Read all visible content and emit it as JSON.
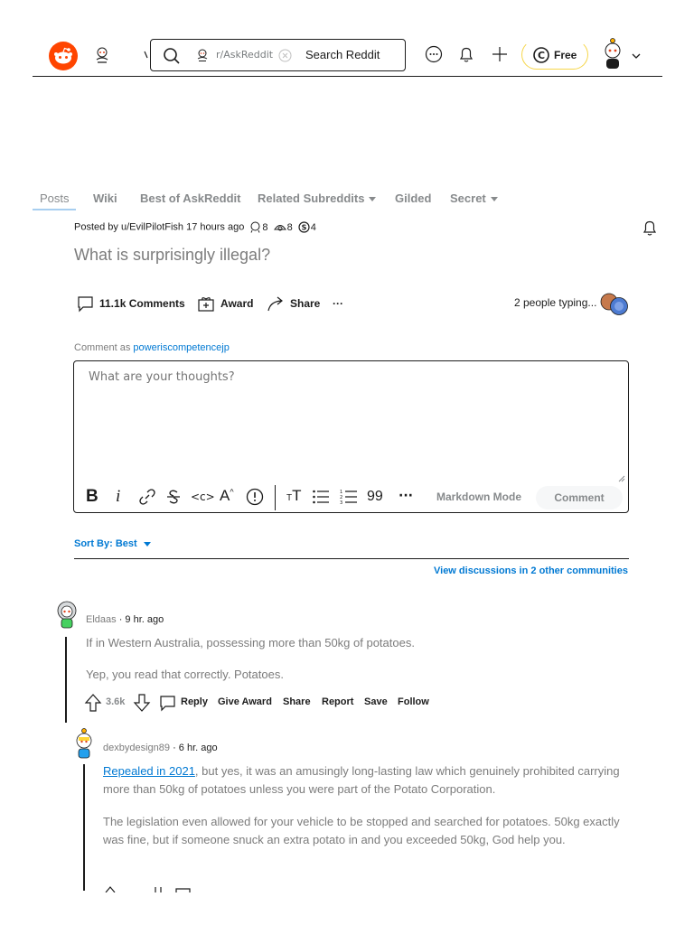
{
  "header": {
    "community_label": "r/AskReddit",
    "search_placeholder": "Search Reddit",
    "free_label": "Free"
  },
  "tabs": [
    {
      "label": "Posts"
    },
    {
      "label": "Wiki"
    },
    {
      "label": "Best of AskReddit"
    },
    {
      "label": "Related Subreddits"
    },
    {
      "label": "Gilded"
    },
    {
      "label": "Secret"
    }
  ],
  "post": {
    "posted_by": "Posted by u/EvilPilotFish",
    "time": "17 hours ago",
    "awards": [
      {
        "icon": "silver-award-icon",
        "count": "8"
      },
      {
        "icon": "helpful-award-icon",
        "count": "8"
      },
      {
        "icon": "coin-award-icon",
        "count": "4"
      }
    ],
    "title": "What is surprisingly illegal?",
    "comments_label": "11.1k Comments",
    "award_label": "Award",
    "share_label": "Share",
    "more_label": "···",
    "typing_label": "2 people typing..."
  },
  "comment_box": {
    "comment_as_prefix": "Comment as",
    "username": "poweriscompetencejp",
    "placeholder": "What are your thoughts?",
    "markdown_mode": "Markdown Mode",
    "comment_button": "Comment",
    "toolbar": [
      "B",
      "i",
      "link",
      "strikethrough",
      "inline-code",
      "superscript",
      "spoiler",
      "heading",
      "bulleted-list",
      "numbered-list",
      "quote",
      "more"
    ]
  },
  "sort": {
    "label": "Sort By: Best",
    "other_communities": "View discussions in 2 other communities"
  },
  "comments": [
    {
      "author": "Eldaas",
      "age": "· 9 hr. ago",
      "paragraphs": [
        "If in Western Australia, possessing more than 50kg of potatoes.",
        "Yep, you read that correctly. Potatoes."
      ],
      "votes": "3.6k",
      "actions": [
        "Reply",
        "Give Award",
        "Share",
        "Report",
        "Save",
        "Follow"
      ]
    },
    {
      "author": "dexbydesign89",
      "age": "· 6 hr. ago",
      "link_text": "Repealed in 2021",
      "paragraph1_rest": ", but yes, it was an amusingly long-lasting law which genuinely prohibited carrying more than 50kg of potatoes unless you were part of the Potato Corporation.",
      "paragraph2": "The legislation even allowed for your vehicle to be stopped and searched for potatoes. 50kg exactly was fine, but if someone snuck an extra potato in and you exceeded 50kg, God help you."
    }
  ],
  "colors": {
    "brand": "#ff4500",
    "link": "#0079d3",
    "muted": "#878a8c"
  }
}
